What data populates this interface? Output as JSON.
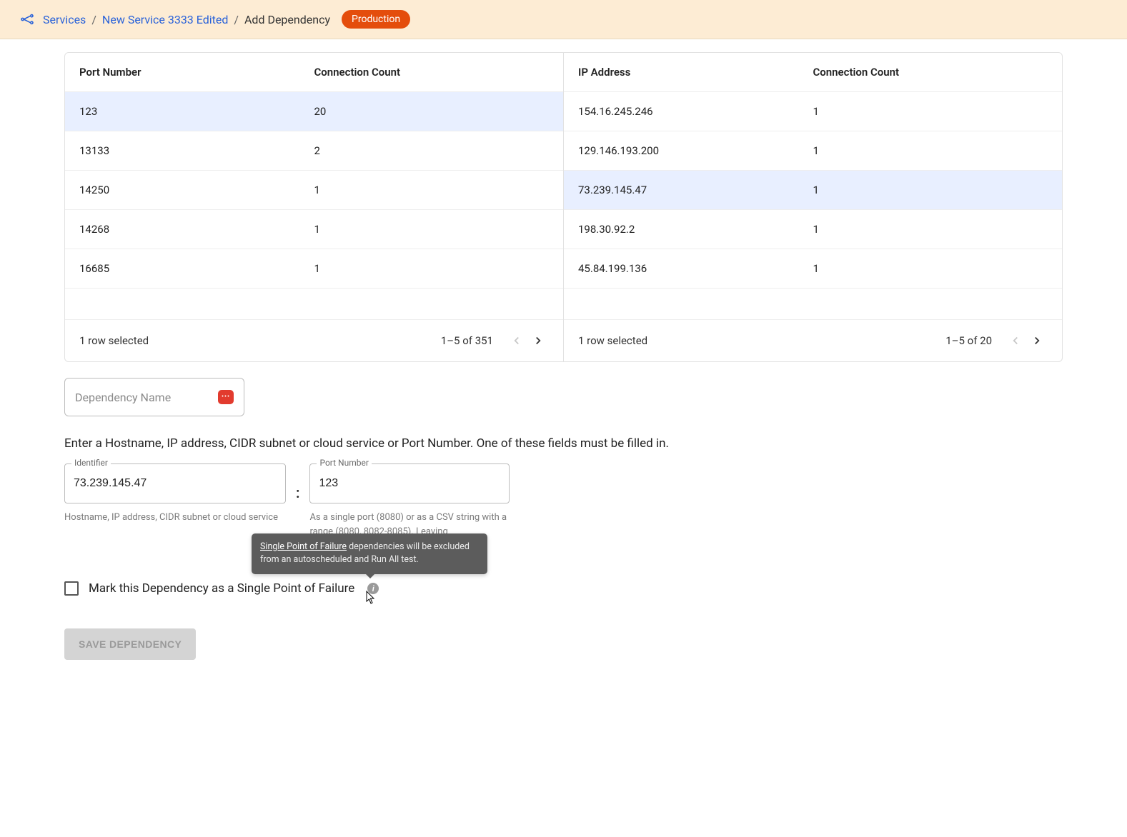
{
  "breadcrumb": {
    "root": "Services",
    "service": "New Service 3333 Edited",
    "current": "Add Dependency",
    "env_badge": "Production"
  },
  "port_table": {
    "headers": {
      "col1": "Port Number",
      "col2": "Connection Count"
    },
    "rows": [
      {
        "port": "123",
        "count": "20",
        "selected": true
      },
      {
        "port": "13133",
        "count": "2",
        "selected": false
      },
      {
        "port": "14250",
        "count": "1",
        "selected": false
      },
      {
        "port": "14268",
        "count": "1",
        "selected": false
      },
      {
        "port": "16685",
        "count": "1",
        "selected": false
      }
    ],
    "footer": {
      "selected_text": "1 row selected",
      "range": "1–5 of 351"
    }
  },
  "ip_table": {
    "headers": {
      "col1": "IP Address",
      "col2": "Connection Count"
    },
    "rows": [
      {
        "ip": "154.16.245.246",
        "count": "1",
        "selected": false
      },
      {
        "ip": "129.146.193.200",
        "count": "1",
        "selected": false
      },
      {
        "ip": "73.239.145.47",
        "count": "1",
        "selected": true
      },
      {
        "ip": "198.30.92.2",
        "count": "1",
        "selected": false
      },
      {
        "ip": "45.84.199.136",
        "count": "1",
        "selected": false
      }
    ],
    "footer": {
      "selected_text": "1 row selected",
      "range": "1–5 of 20"
    }
  },
  "dep_name": {
    "placeholder": "Dependency Name"
  },
  "instruction": "Enter a Hostname, IP address, CIDR subnet or cloud service or Port Number. One of these fields must be filled in.",
  "identifier_field": {
    "label": "Identifier",
    "value": "73.239.145.47",
    "help": "Hostname, IP address, CIDR subnet or cloud service"
  },
  "port_field": {
    "label": "Port Number",
    "value": "123",
    "help": "As a single port (8080) or as a CSV string with a range (8080, 8082-8085). Leaving"
  },
  "spof": {
    "label": "Mark this Dependency as a Single Point of Failure",
    "tooltip_link": "Single Point of Failure",
    "tooltip_rest": " dependencies will be excluded from an autoscheduled and Run All test."
  },
  "save_button": "SAVE DEPENDENCY"
}
